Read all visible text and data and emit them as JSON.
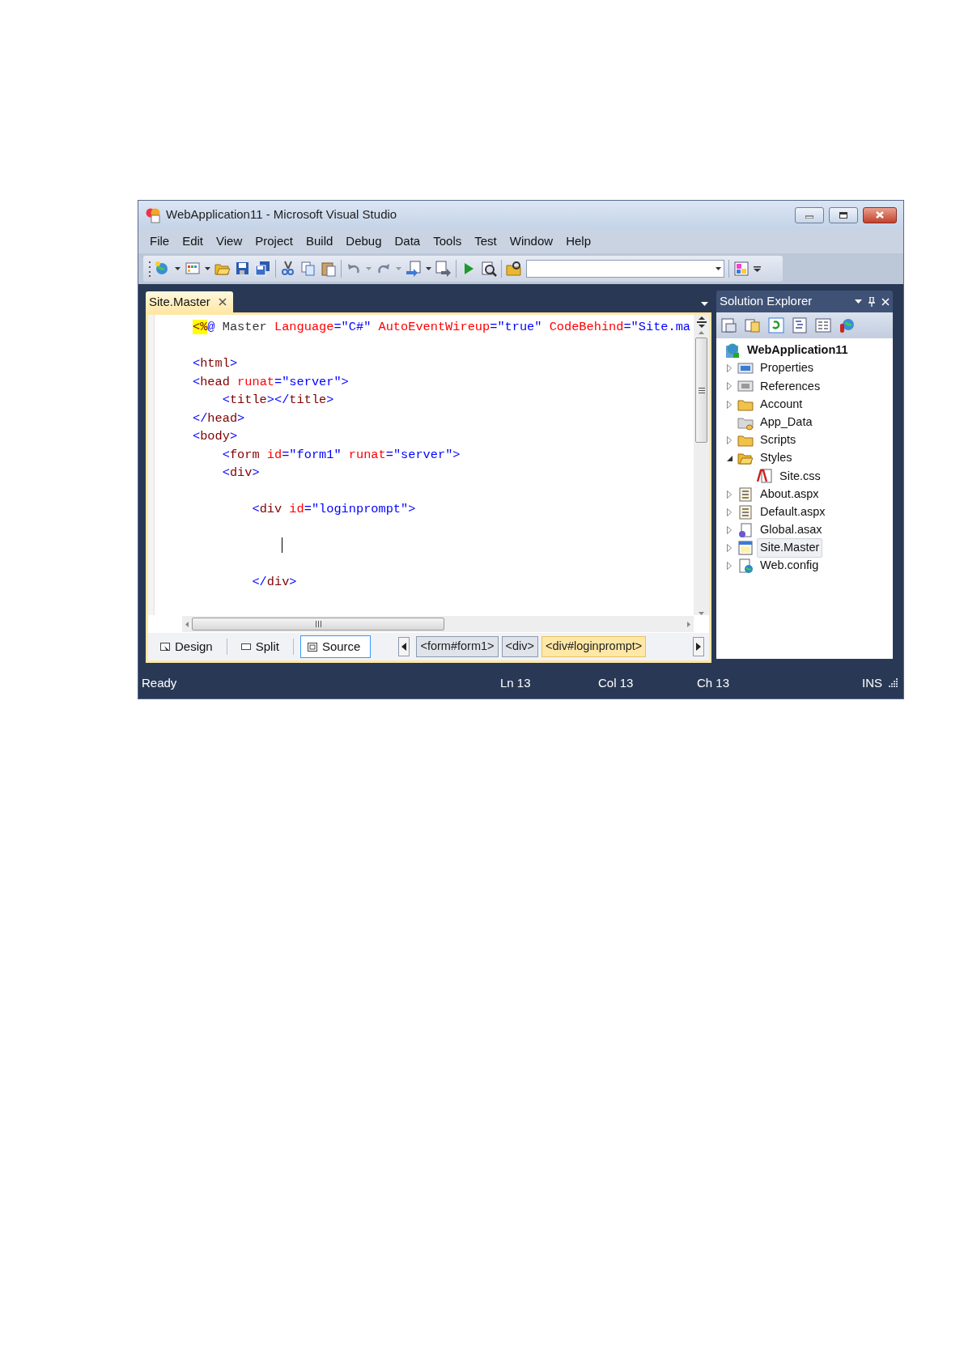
{
  "window": {
    "title": "WebApplication11 - Microsoft Visual Studio"
  },
  "menu": [
    "File",
    "Edit",
    "View",
    "Project",
    "Build",
    "Debug",
    "Data",
    "Tools",
    "Test",
    "Window",
    "Help"
  ],
  "document_tabs": [
    {
      "label": "Site.Master",
      "selected": true
    }
  ],
  "code_lines": [
    {
      "kind": "code",
      "tokens": [
        {
          "text": "<%",
          "kind": "highlight"
        },
        {
          "text": "@",
          "kind": "tag"
        },
        {
          "text": " Master ",
          "kind": "plain"
        },
        {
          "text": "Language",
          "kind": "attr"
        },
        {
          "text": "=\"C#\" ",
          "kind": "value"
        },
        {
          "text": "AutoEventWireup",
          "kind": "attr"
        },
        {
          "text": "=\"true\" ",
          "kind": "value"
        },
        {
          "text": "CodeBehind",
          "kind": "attr"
        },
        {
          "text": "=\"Site.ma",
          "kind": "value"
        }
      ]
    },
    {
      "kind": "blank"
    },
    {
      "kind": "code",
      "tokens": [
        {
          "text": "<",
          "kind": "tag"
        },
        {
          "text": "html",
          "kind": "element"
        },
        {
          "text": ">",
          "kind": "tag"
        }
      ]
    },
    {
      "kind": "code",
      "tokens": [
        {
          "text": "<",
          "kind": "tag"
        },
        {
          "text": "head ",
          "kind": "element"
        },
        {
          "text": "runat",
          "kind": "attr"
        },
        {
          "text": "=\"server\">",
          "kind": "value"
        }
      ]
    },
    {
      "kind": "code",
      "tokens": [
        {
          "text": "    <",
          "kind": "tag"
        },
        {
          "text": "title",
          "kind": "element"
        },
        {
          "text": "></",
          "kind": "tag"
        },
        {
          "text": "title",
          "kind": "element"
        },
        {
          "text": ">",
          "kind": "tag"
        }
      ]
    },
    {
      "kind": "code",
      "tokens": [
        {
          "text": "</",
          "kind": "tag"
        },
        {
          "text": "head",
          "kind": "element"
        },
        {
          "text": ">",
          "kind": "tag"
        }
      ]
    },
    {
      "kind": "code",
      "tokens": [
        {
          "text": "<",
          "kind": "tag"
        },
        {
          "text": "body",
          "kind": "element"
        },
        {
          "text": ">",
          "kind": "tag"
        }
      ]
    },
    {
      "kind": "code",
      "tokens": [
        {
          "text": "    <",
          "kind": "tag"
        },
        {
          "text": "form ",
          "kind": "element"
        },
        {
          "text": "id",
          "kind": "attr"
        },
        {
          "text": "=\"form1\" ",
          "kind": "value"
        },
        {
          "text": "runat",
          "kind": "attr"
        },
        {
          "text": "=\"server\">",
          "kind": "value"
        }
      ]
    },
    {
      "kind": "code",
      "tokens": [
        {
          "text": "    <",
          "kind": "tag"
        },
        {
          "text": "div",
          "kind": "element"
        },
        {
          "text": ">",
          "kind": "tag"
        }
      ]
    },
    {
      "kind": "blank"
    },
    {
      "kind": "code",
      "tokens": [
        {
          "text": "        <",
          "kind": "tag"
        },
        {
          "text": "div ",
          "kind": "element"
        },
        {
          "text": "id",
          "kind": "attr"
        },
        {
          "text": "=\"loginprompt\">",
          "kind": "value"
        }
      ]
    },
    {
      "kind": "blank"
    },
    {
      "kind": "caret"
    },
    {
      "kind": "blank"
    },
    {
      "kind": "code",
      "tokens": [
        {
          "text": "        </",
          "kind": "tag"
        },
        {
          "text": "div",
          "kind": "element"
        },
        {
          "text": ">",
          "kind": "tag"
        }
      ]
    },
    {
      "kind": "blank"
    }
  ],
  "view_tabs": [
    {
      "label": "Design",
      "kind": "design",
      "selected": false
    },
    {
      "label": "Split",
      "kind": "split",
      "selected": false
    },
    {
      "label": "Source",
      "kind": "source",
      "selected": true
    }
  ],
  "breadcrumbs": [
    {
      "label": "<form#form1>",
      "selected": false
    },
    {
      "label": "<div>",
      "selected": false
    },
    {
      "label": "<div#loginprompt>",
      "selected": true
    }
  ],
  "solution_explorer": {
    "title": "Solution Explorer",
    "root": {
      "label": "WebApplication11",
      "kind": "project",
      "children": [
        {
          "label": "Properties",
          "kind": "properties",
          "expanded": false,
          "selected": false
        },
        {
          "label": "References",
          "kind": "references",
          "expanded": false,
          "selected": false
        },
        {
          "label": "Account",
          "kind": "folder",
          "expanded": false,
          "selected": false
        },
        {
          "label": "App_Data",
          "kind": "datafolder",
          "selected": false
        },
        {
          "label": "Scripts",
          "kind": "folder",
          "expanded": false,
          "selected": false
        },
        {
          "label": "Styles",
          "kind": "folder",
          "expanded": true,
          "selected": false,
          "children": [
            {
              "label": "Site.css",
              "kind": "css",
              "selected": false
            }
          ]
        },
        {
          "label": "About.aspx",
          "kind": "page",
          "expanded": false,
          "selected": false
        },
        {
          "label": "Default.aspx",
          "kind": "page",
          "expanded": false,
          "selected": false
        },
        {
          "label": "Global.asax",
          "kind": "global",
          "expanded": false,
          "selected": false
        },
        {
          "label": "Site.Master",
          "kind": "master",
          "expanded": false,
          "selected": true
        },
        {
          "label": "Web.config",
          "kind": "config",
          "expanded": false,
          "selected": false
        }
      ]
    }
  },
  "status_bar": {
    "message": "Ready",
    "line": "Ln 13",
    "column": "Col 13",
    "char": "Ch 13",
    "mode": "INS"
  }
}
